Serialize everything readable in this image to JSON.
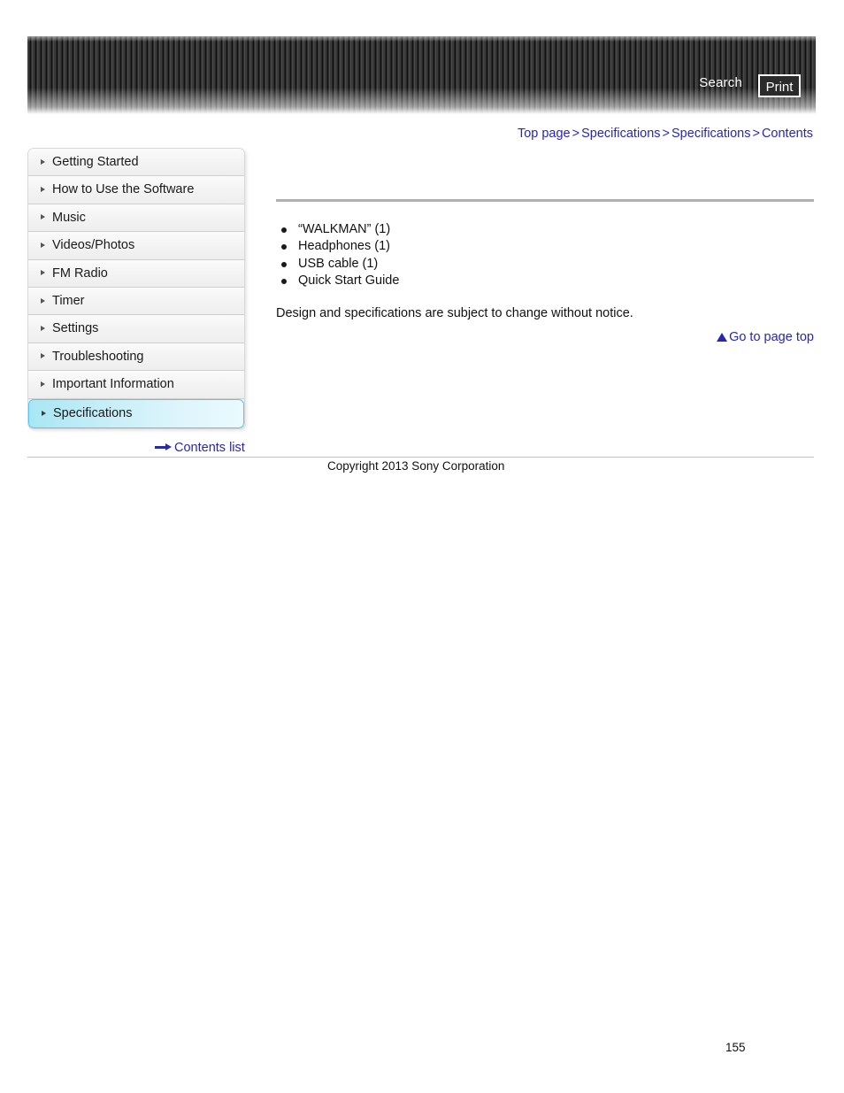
{
  "header": {
    "search_label": "Search",
    "print_label": "Print"
  },
  "breadcrumb": {
    "items": [
      {
        "label": "Top page"
      },
      {
        "label": "Specifications"
      },
      {
        "label": "Specifications"
      },
      {
        "label": "Contents"
      }
    ],
    "separator": ">"
  },
  "sidebar": {
    "items": [
      {
        "label": "Getting Started",
        "selected": false
      },
      {
        "label": "How to Use the Software",
        "selected": false
      },
      {
        "label": "Music",
        "selected": false
      },
      {
        "label": "Videos/Photos",
        "selected": false
      },
      {
        "label": "FM Radio",
        "selected": false
      },
      {
        "label": "Timer",
        "selected": false
      },
      {
        "label": "Settings",
        "selected": false
      },
      {
        "label": "Troubleshooting",
        "selected": false
      },
      {
        "label": "Important Information",
        "selected": false
      },
      {
        "label": "Specifications",
        "selected": true
      }
    ],
    "contents_list_label": "Contents list"
  },
  "main": {
    "items": [
      {
        "text": "“WALKMAN” (1)"
      },
      {
        "text": "Headphones (1)"
      },
      {
        "text": "USB cable (1)"
      },
      {
        "text": "Quick Start Guide"
      }
    ],
    "notice": "Design and specifications are subject to change without notice.",
    "go_to_top_label": "Go to page top"
  },
  "footer": {
    "copyright": "Copyright 2013 Sony Corporation",
    "page_number": "155"
  },
  "colors": {
    "link": "#2727b0",
    "selected_nav": "#a9e6f4",
    "banner_dark": "#2b2b2b"
  }
}
